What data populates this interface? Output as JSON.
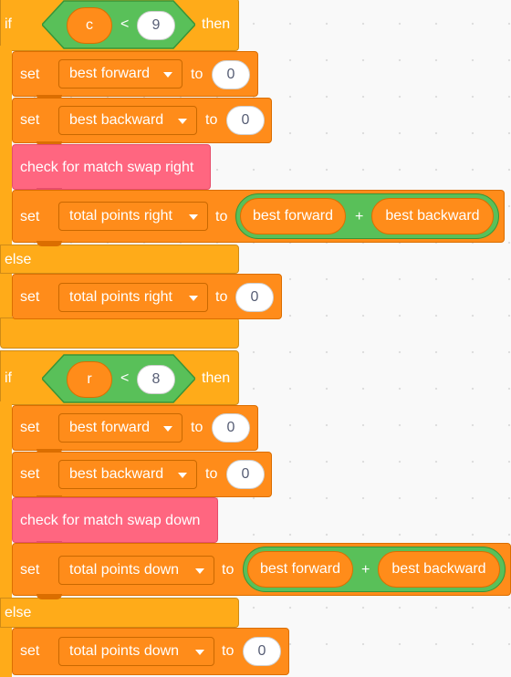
{
  "labels": {
    "if": "if",
    "then": "then",
    "else": "else",
    "set": "set",
    "to": "to",
    "plus": "+",
    "less": "<"
  },
  "block1": {
    "cond_var": "c",
    "cond_num": "9",
    "set1_var": "best forward",
    "set1_val": "0",
    "set2_var": "best backward",
    "set2_val": "0",
    "call": "check for match swap right",
    "set3_var": "total points right",
    "sum_a": "best forward",
    "sum_b": "best backward",
    "else_var": "total points right",
    "else_val": "0"
  },
  "block2": {
    "cond_var": "r",
    "cond_num": "8",
    "set1_var": "best forward",
    "set1_val": "0",
    "set2_var": "best backward",
    "set2_val": "0",
    "call": "check for match swap down",
    "set3_var": "total points down",
    "sum_a": "best forward",
    "sum_b": "best backward",
    "else_var": "total points down",
    "else_val": "0"
  },
  "colors": {
    "control": "#ffab19",
    "variables": "#ff8c1a",
    "operators": "#59c059",
    "my_blocks": "#ff6680",
    "canvas": "#f9f9f9"
  }
}
